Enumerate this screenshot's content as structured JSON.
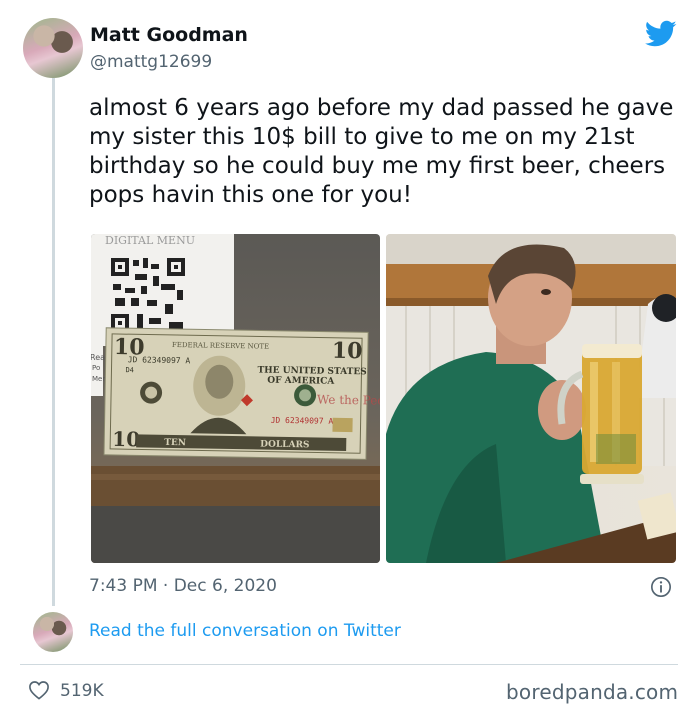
{
  "tweet": {
    "author_name": "Matt Goodman",
    "author_handle": "@mattg12699",
    "text": "almost 6 years ago before my dad passed he gave my sister this 10$ bill to give to me on my 21st birthday so he could buy me my first beer, cheers pops havin this one for you!",
    "timestamp": "7:43 PM · Dec 6, 2020",
    "reply_link": "Read the full conversation on Twitter",
    "likes": "519K"
  },
  "photos": {
    "left": {
      "menu_text": "DIGITAL MENU",
      "side_text_1": "Read",
      "side_text_2": "Po",
      "side_text_3": "Menu",
      "bill_serial": "JD 62349097 A",
      "bill_letter": "D4",
      "bill_header": "FEDERAL RESERVE NOTE",
      "bill_title_1": "THE UNITED STATES",
      "bill_title_2": "OF AMERICA",
      "bill_we": "We the People",
      "bill_ten": "TEN",
      "bill_dollars": "DOLLARS",
      "bill_value": "10"
    }
  },
  "watermark": "boredpanda.com",
  "colors": {
    "accent": "#1d9bf0",
    "secondary_text": "#536471",
    "divider": "#cfd9de"
  },
  "icons": {
    "brand": "twitter-bird-icon",
    "info": "info-icon",
    "like": "heart-icon"
  }
}
